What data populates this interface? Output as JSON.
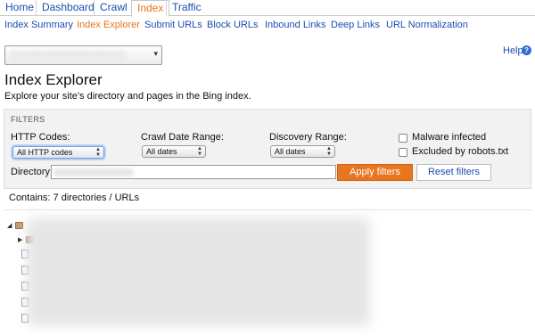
{
  "tabs": [
    {
      "label": "Home",
      "active": false
    },
    {
      "label": "Dashboard",
      "active": false
    },
    {
      "label": "Crawl",
      "active": false
    },
    {
      "label": "Index",
      "active": true
    },
    {
      "label": "Traffic",
      "active": false
    }
  ],
  "subnav": [
    {
      "label": "Index Summary",
      "active": false
    },
    {
      "label": "Index Explorer",
      "active": true
    },
    {
      "label": "Submit URLs",
      "active": false
    },
    {
      "label": "Block URLs",
      "active": false
    },
    {
      "label": "Inbound Links",
      "active": false
    },
    {
      "label": "Deep Links",
      "active": false
    },
    {
      "label": "URL Normalization",
      "active": false
    }
  ],
  "help": {
    "label": "Help",
    "icon": "help-icon"
  },
  "page": {
    "title": "Index Explorer",
    "description": "Explore your site's directory and pages in the Bing index."
  },
  "filters": {
    "title": "FILTERS",
    "http_codes": {
      "label": "HTTP Codes:",
      "value": "All HTTP codes"
    },
    "crawl_date": {
      "label": "Crawl Date Range:",
      "value": "All dates"
    },
    "discovery": {
      "label": "Discovery Range:",
      "value": "All dates"
    },
    "malware": {
      "label": "Malware infected",
      "checked": false
    },
    "robots": {
      "label": "Excluded by robots.txt",
      "checked": false
    },
    "directory": {
      "label": "Directory:"
    },
    "apply_label": "Apply filters",
    "reset_label": "Reset filters"
  },
  "results": {
    "contains": "Contains: 7 directories / URLs"
  },
  "colors": {
    "accent": "#e8761f",
    "link": "#1a4fb0",
    "panel": "#f2f2f2"
  }
}
